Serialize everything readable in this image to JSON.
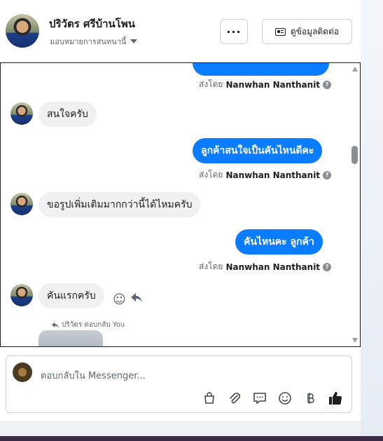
{
  "header": {
    "name": "ปริวัตร ศรีบ้านโพน",
    "assign": "มอบหมายการสนทนานี้",
    "more_label": "···",
    "contact_label": "ดูข้อมูลติดต่อ"
  },
  "messages": {
    "sent_prefix": "ส่งโดย",
    "agent": "Nanwhan Nanthanit",
    "m1": "สนใจครับ",
    "m2": "ลูกค้าสนใจเป็นคันไหนดีคะ",
    "m3": "ขอรูปเพิ่มเติมมากกว่านี้ได้ไหมครับ",
    "m4": "คันไหนคะ  ลูกค้า",
    "m5": "คันแรกครับ",
    "reply_note": "ปริวัตร ตอบกลับ You",
    "qmark": "?"
  },
  "composer": {
    "placeholder": "ตอบกลับใน Messenger..."
  },
  "icons": {
    "more": "more-icon",
    "contact": "contact-card-icon",
    "emoji": "emoji-icon",
    "reply": "reply-icon",
    "bag": "shopping-bag-icon",
    "attach": "paperclip-icon",
    "chat": "chat-bubble-icon",
    "baht": "baht-icon",
    "like": "thumbs-up-icon"
  },
  "colors": {
    "accent": "#0a7cff"
  }
}
